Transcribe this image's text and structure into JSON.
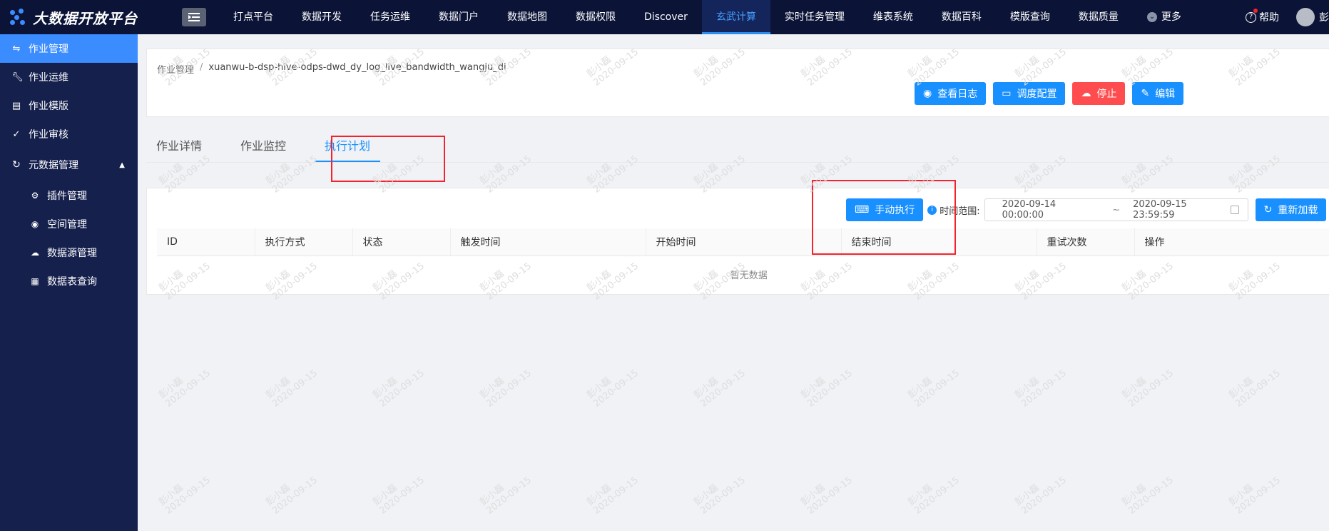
{
  "app": {
    "logo_text": "大数据开放平台"
  },
  "topnav": {
    "items": [
      "打点平台",
      "数据开发",
      "任务运维",
      "数据门户",
      "数据地图",
      "数据权限",
      "Discover",
      "玄武计算",
      "实时任务管理",
      "维表系统",
      "数据百科",
      "模版查询",
      "数据质量"
    ],
    "active_index": 7,
    "more_label": "更多",
    "help_label": "帮助",
    "user_initial": "彭"
  },
  "sidebar": {
    "items": [
      {
        "label": "作业管理",
        "icon": "swap-icon",
        "active": true
      },
      {
        "label": "作业运维",
        "icon": "wrench-icon"
      },
      {
        "label": "作业模版",
        "icon": "document-icon"
      },
      {
        "label": "作业审核",
        "icon": "check-icon"
      }
    ],
    "group": {
      "label": "元数据管理",
      "icon": "refresh-icon",
      "expanded": true
    },
    "sub_items": [
      {
        "label": "插件管理",
        "icon": "plugin-icon"
      },
      {
        "label": "空间管理",
        "icon": "space-icon"
      },
      {
        "label": "数据源管理",
        "icon": "cloud-icon"
      },
      {
        "label": "数据表查询",
        "icon": "table-icon"
      }
    ]
  },
  "breadcrumb": {
    "root": "作业管理",
    "separator": "/",
    "current": "xuanwu-b-dsp-hive-odps-dwd_dy_log_live_bandwidth_wangju_di"
  },
  "header_actions": {
    "view_log": "查看日志",
    "schedule_config": "调度配置",
    "stop": "停止",
    "edit": "编辑"
  },
  "tabs": {
    "items": [
      "作业详情",
      "作业监控",
      "执行计划"
    ],
    "active_index": 2
  },
  "toolbar": {
    "manual_run": "手动执行",
    "time_range_label": "时间范围:",
    "date_start": "2020-09-14 00:00:00",
    "date_sep": "~",
    "date_end": "2020-09-15 23:59:59",
    "reload": "重新加载"
  },
  "table": {
    "columns": [
      "ID",
      "执行方式",
      "状态",
      "触发时间",
      "开始时间",
      "结束时间",
      "重试次数",
      "操作"
    ],
    "empty_text": "暂无数据"
  },
  "watermark": {
    "name": "彭小磊",
    "date": "2020-09-15"
  },
  "colors": {
    "topbar": "#0b1437",
    "sidebar": "#15204d",
    "primary": "#1890ff",
    "danger": "#ff4d4f",
    "annotation": "#f5222d"
  }
}
